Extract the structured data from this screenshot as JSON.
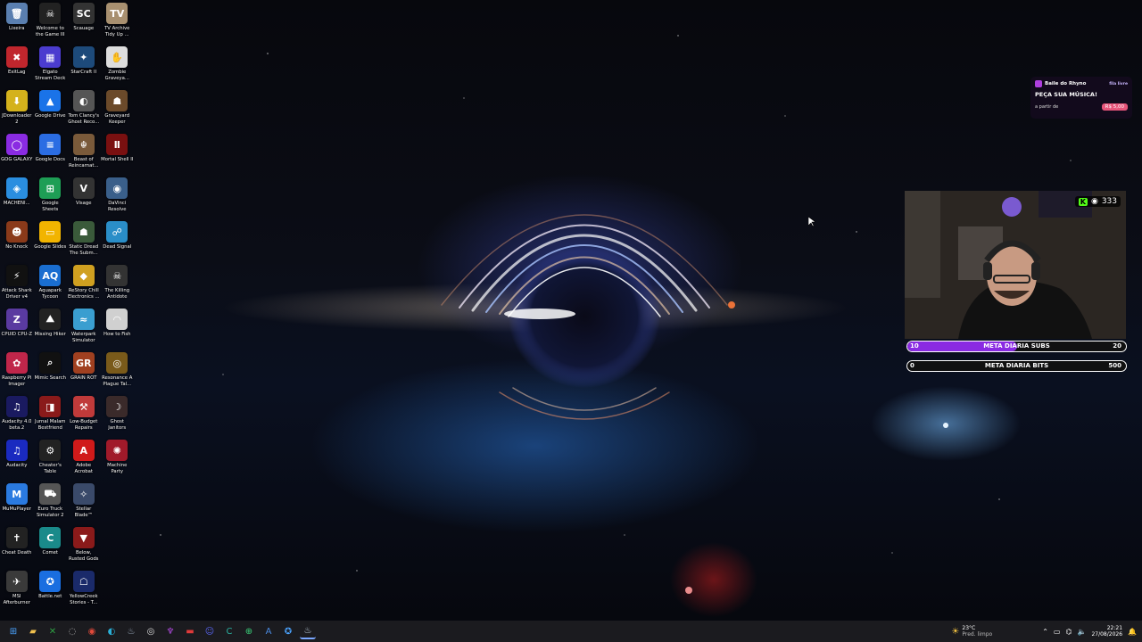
{
  "desktop": {
    "icons": [
      {
        "label": "Lixeira",
        "glyph": "🗑",
        "color": "#5a7fb0"
      },
      {
        "label": "Welcome to the Game III",
        "glyph": "☠",
        "color": "#222"
      },
      {
        "label": "Scauage",
        "glyph": "SC",
        "color": "#333"
      },
      {
        "label": "TV Archive Tidy Up ...",
        "glyph": "TV",
        "color": "#a89070"
      },
      {
        "label": "ExitLag",
        "glyph": "✖",
        "color": "#c0262d"
      },
      {
        "label": "Elgato Stream Deck",
        "glyph": "▦",
        "color": "#4b3ccf"
      },
      {
        "label": "StarCraft II",
        "glyph": "✦",
        "color": "#1d4a7a"
      },
      {
        "label": "Zombie Graveya...",
        "glyph": "✋",
        "color": "#ddd"
      },
      {
        "label": "JDownloader 2",
        "glyph": "⬇",
        "color": "#d4b21c"
      },
      {
        "label": "Google Drive",
        "glyph": "▲",
        "color": "#1a73e8"
      },
      {
        "label": "Tom Clancy's Ghost Reco...",
        "glyph": "◐",
        "color": "#555"
      },
      {
        "label": "Graveyard Keeper",
        "glyph": "☗",
        "color": "#6b4a2a"
      },
      {
        "label": "GOG GALAXY",
        "glyph": "◯",
        "color": "#8a2be2"
      },
      {
        "label": "Google Docs",
        "glyph": "≡",
        "color": "#2b6de3"
      },
      {
        "label": "Beast of Reincarnat...",
        "glyph": "☬",
        "color": "#7a5a3a"
      },
      {
        "label": "Mortal Shell II",
        "glyph": "Ⅱ",
        "color": "#7a1010"
      },
      {
        "label": "MACHENI...",
        "glyph": "◈",
        "color": "#2a8ee0"
      },
      {
        "label": "Google Sheets",
        "glyph": "⊞",
        "color": "#1e9e55"
      },
      {
        "label": "Visage",
        "glyph": "V",
        "color": "#333"
      },
      {
        "label": "DaVinci Resolve",
        "glyph": "◉",
        "color": "#3a5f8a"
      },
      {
        "label": "No Knock",
        "glyph": "☻",
        "color": "#8a3a1a"
      },
      {
        "label": "Google Slides",
        "glyph": "▭",
        "color": "#f2b400"
      },
      {
        "label": "Static Dread The Subm...",
        "glyph": "☗",
        "color": "#3a5a3a"
      },
      {
        "label": "Dead Signal",
        "glyph": "☍",
        "color": "#2a8ec8"
      },
      {
        "label": "Attack Shark Driver v4",
        "glyph": "⚡",
        "color": "#111"
      },
      {
        "label": "Aquapark Tycoon",
        "glyph": "AQ",
        "color": "#1a6ed0"
      },
      {
        "label": "ReStory Chill Electronics ...",
        "glyph": "◆",
        "color": "#d0a020"
      },
      {
        "label": "The Killing Antidote",
        "glyph": "☠",
        "color": "#333"
      },
      {
        "label": "CPUID CPU-Z",
        "glyph": "Z",
        "color": "#5a3aa0"
      },
      {
        "label": "Missing Hiker",
        "glyph": "⛰",
        "color": "#222"
      },
      {
        "label": "Waterpark Simulator",
        "glyph": "≈",
        "color": "#3a9ed0"
      },
      {
        "label": "How to Fish",
        "glyph": "◠",
        "color": "#d0d0d0"
      },
      {
        "label": "Raspberry Pi Imager",
        "glyph": "✿",
        "color": "#c0264a"
      },
      {
        "label": "Mimic Search",
        "glyph": "⌕",
        "color": "#111"
      },
      {
        "label": "GRAIN ROT",
        "glyph": "GR",
        "color": "#a04020"
      },
      {
        "label": "Resonance A Plague Tal...",
        "glyph": "◎",
        "color": "#7a5a1a"
      },
      {
        "label": "Audacity 4.0 beta.2",
        "glyph": "♫",
        "color": "#1a1a60"
      },
      {
        "label": "Jurnal Malam Bestfriend",
        "glyph": "◨",
        "color": "#8a1a1a"
      },
      {
        "label": "Low-Budget Repairs",
        "glyph": "⚒",
        "color": "#c03a3a"
      },
      {
        "label": "Ghost Janitors",
        "glyph": "☽",
        "color": "#3a2a2a"
      },
      {
        "label": "Audacity",
        "glyph": "♫",
        "color": "#1a2ac0"
      },
      {
        "label": "Cheater's Table",
        "glyph": "⚙",
        "color": "#222"
      },
      {
        "label": "Adobe Acrobat",
        "glyph": "A",
        "color": "#d01a1a"
      },
      {
        "label": "Machine Party",
        "glyph": "✺",
        "color": "#a01a2a"
      },
      {
        "label": "MuMuPlayer",
        "glyph": "M",
        "color": "#2a7ae0"
      },
      {
        "label": "Euro Truck Simulator 2",
        "glyph": "⛟",
        "color": "#555"
      },
      {
        "label": "Stellar Blade™",
        "glyph": "✧",
        "color": "#3a4a6a"
      },
      {
        "label": "",
        "glyph": "",
        "color": "transparent"
      },
      {
        "label": "Cheat Death",
        "glyph": "✝",
        "color": "#222"
      },
      {
        "label": "Comet",
        "glyph": "C",
        "color": "#1a8a8a"
      },
      {
        "label": "Below, Rusted Gods",
        "glyph": "▼",
        "color": "#8a1a1a"
      },
      {
        "label": "",
        "glyph": "",
        "color": "transparent"
      },
      {
        "label": "MSI Afterburner",
        "glyph": "✈",
        "color": "#3a3a3a"
      },
      {
        "label": "Battle.net",
        "glyph": "✪",
        "color": "#1a6ee0"
      },
      {
        "label": "YellowCreek Stories - T...",
        "glyph": "☖",
        "color": "#1a2a6a"
      },
      {
        "label": "",
        "glyph": "",
        "color": "transparent"
      }
    ]
  },
  "song_widget": {
    "channel": "Baile do Rhyno",
    "tag": "fila livre",
    "headline": "PEÇA SUA MÚSICA!",
    "from_label": "a partir de",
    "price": "R$ 5,00"
  },
  "webcam": {
    "viewers": "333"
  },
  "goals": [
    {
      "current": "10",
      "title": "META DIARIA SUBS",
      "target": "20",
      "progress": 0.5
    },
    {
      "current": "0",
      "title": "META DIARIA BITS",
      "target": "500",
      "progress": 0
    }
  ],
  "taskbar": {
    "apps": [
      "windows-start",
      "file-explorer",
      "xbox",
      "chromium",
      "chrome",
      "edge",
      "steam",
      "obs",
      "game-app",
      "red-app",
      "discord",
      "comet",
      "green-app",
      "blue-app",
      "battle-net",
      "steam-active"
    ],
    "weather_temp": "23°C",
    "weather_desc": "Pred. limpo",
    "time": "22:21",
    "date": "27/08/2026"
  }
}
